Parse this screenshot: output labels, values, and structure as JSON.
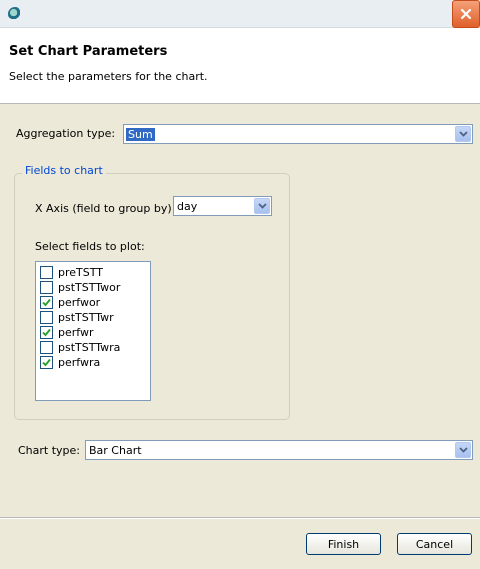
{
  "window": {
    "icon": "eclipse-app-icon",
    "close_icon": "close-icon"
  },
  "header": {
    "title": "Set Chart Parameters",
    "description": "Select the parameters for the chart."
  },
  "aggregation": {
    "label": "Aggregation type:",
    "value": "Sum"
  },
  "fields_group": {
    "title": "Fields to chart",
    "x_axis_label": "X Axis (field to group by)",
    "x_axis_value": "day",
    "select_fields_label": "Select fields to plot:",
    "fields": [
      {
        "label": "preTSTT",
        "checked": false
      },
      {
        "label": "pstTSTTwor",
        "checked": false
      },
      {
        "label": "perfwor",
        "checked": true
      },
      {
        "label": "pstTSTTwr",
        "checked": false
      },
      {
        "label": "perfwr",
        "checked": true
      },
      {
        "label": "pstTSTTwra",
        "checked": false
      },
      {
        "label": "perfwra",
        "checked": true
      }
    ]
  },
  "chart_type": {
    "label": "Chart type:",
    "value": "Bar Chart"
  },
  "buttons": {
    "finish": "Finish",
    "cancel": "Cancel"
  },
  "colors": {
    "accent": "#316ac5",
    "group_title": "#0046d5",
    "close_button": "#e0602a",
    "check_mark": "#21a121"
  }
}
